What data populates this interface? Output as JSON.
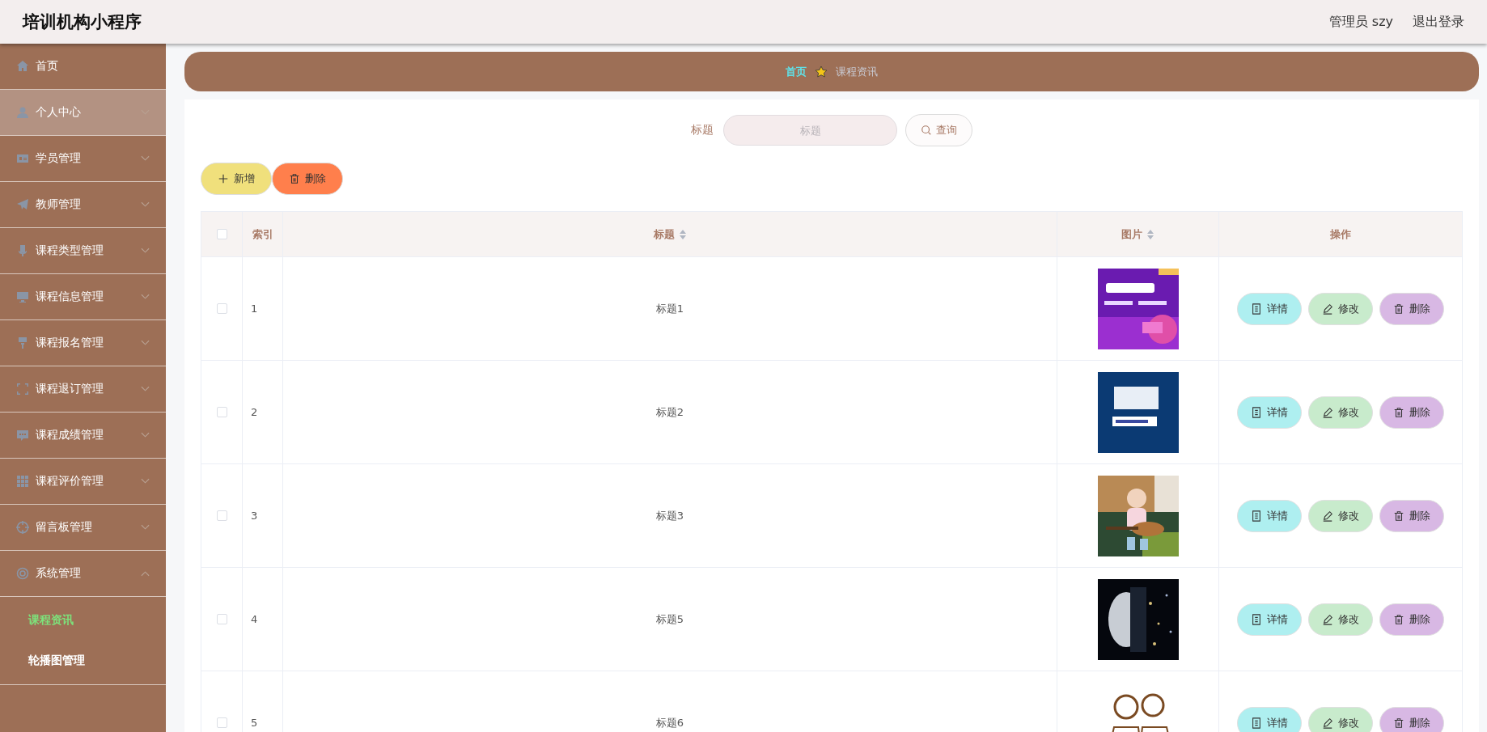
{
  "header": {
    "title": "培训机构小程序",
    "user": "管理员 szy",
    "logout": "退出登录"
  },
  "sidebar": {
    "items": [
      {
        "label": "首页",
        "kind": "link",
        "selected": false
      },
      {
        "label": "个人中心",
        "kind": "submenu",
        "selected": true,
        "expanded": false
      },
      {
        "label": "学员管理",
        "kind": "submenu",
        "selected": false,
        "expanded": false
      },
      {
        "label": "教师管理",
        "kind": "submenu",
        "selected": false,
        "expanded": false
      },
      {
        "label": "课程类型管理",
        "kind": "submenu",
        "selected": false,
        "expanded": false
      },
      {
        "label": "课程信息管理",
        "kind": "submenu",
        "selected": false,
        "expanded": false
      },
      {
        "label": "课程报名管理",
        "kind": "submenu",
        "selected": false,
        "expanded": false
      },
      {
        "label": "课程退订管理",
        "kind": "submenu",
        "selected": false,
        "expanded": false
      },
      {
        "label": "课程成绩管理",
        "kind": "submenu",
        "selected": false,
        "expanded": false
      },
      {
        "label": "课程评价管理",
        "kind": "submenu",
        "selected": false,
        "expanded": false
      },
      {
        "label": "留言板管理",
        "kind": "submenu",
        "selected": false,
        "expanded": false
      },
      {
        "label": "系统管理",
        "kind": "submenu",
        "selected": false,
        "expanded": true,
        "children": [
          {
            "label": "课程资讯",
            "selected": true
          },
          {
            "label": "轮播图管理",
            "selected": false
          }
        ]
      }
    ]
  },
  "breadcrumb": {
    "home": "首页",
    "current": "课程资讯"
  },
  "search": {
    "label": "标题",
    "placeholder": "标题",
    "button": "查询"
  },
  "actions": {
    "add": "新增",
    "delete": "删除"
  },
  "table": {
    "header_checked": false,
    "columns": [
      {
        "label": "索引",
        "sortable": false
      },
      {
        "label": "标题",
        "sortable": true
      },
      {
        "label": "图片",
        "sortable": true
      },
      {
        "label": "操作",
        "sortable": false
      }
    ],
    "rows": [
      {
        "checked": false,
        "index": "1",
        "title": "标题1",
        "image": {
          "kind": "picture"
        },
        "buttons": [
          "详情",
          "修改",
          "删除"
        ]
      },
      {
        "checked": false,
        "index": "2",
        "title": "标题2",
        "image": {
          "kind": "picture"
        },
        "buttons": [
          "详情",
          "修改",
          "删除"
        ]
      },
      {
        "checked": false,
        "index": "3",
        "title": "标题3",
        "image": {
          "kind": "picture"
        },
        "buttons": [
          "详情",
          "修改",
          "删除"
        ]
      },
      {
        "checked": false,
        "index": "4",
        "title": "标题5",
        "image": {
          "kind": "picture"
        },
        "buttons": [
          "详情",
          "修改",
          "删除"
        ]
      },
      {
        "checked": false,
        "index": "5",
        "title": "标题6",
        "image": {
          "kind": "picture"
        },
        "buttons": [
          "详情",
          "修改",
          "删除"
        ]
      }
    ]
  }
}
